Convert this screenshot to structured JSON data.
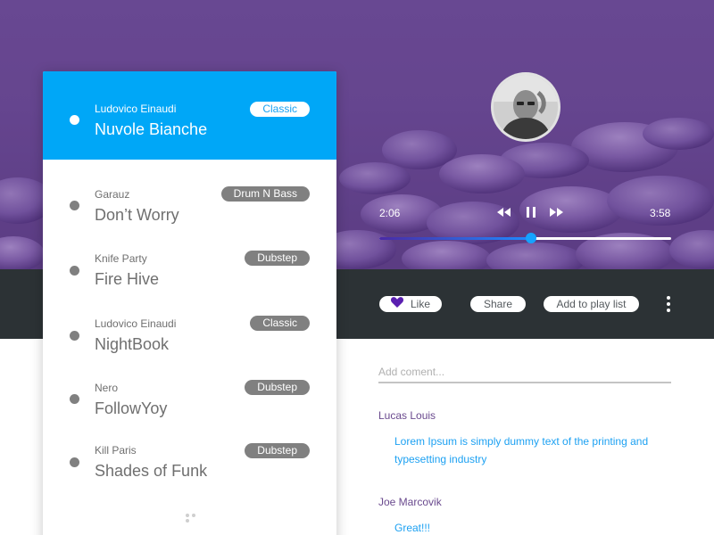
{
  "player": {
    "current_time": "2:06",
    "total_time": "3:58",
    "progress": 0.52,
    "controls": [
      "rewind-icon",
      "pause-icon",
      "fast-forward-icon"
    ]
  },
  "actions": {
    "like_label": "Like",
    "share_label": "Share",
    "add_label": "Add to play list"
  },
  "comments": {
    "placeholder": "Add coment...",
    "items": [
      {
        "author": "Lucas Louis",
        "text": "Lorem Ipsum is simply dummy text of the printing and typesetting industry"
      },
      {
        "author": "Joe Marcovik",
        "text": "Great!!!"
      }
    ]
  },
  "playlist": {
    "items": [
      {
        "artist": "Ludovico Einaudi",
        "title": "Nuvole Bianche",
        "genre": "Classic",
        "active": true
      },
      {
        "artist": "Garauz",
        "title": "Don’t Worry",
        "genre": "Drum N Bass",
        "active": false
      },
      {
        "artist": "Knife Party",
        "title": "Fire Hive",
        "genre": "Dubstep",
        "active": false
      },
      {
        "artist": "Ludovico Einaudi",
        "title": "NightBook",
        "genre": "Classic",
        "active": false
      },
      {
        "artist": "Nero",
        "title": "FollowYoy",
        "genre": "Dubstep",
        "active": false
      },
      {
        "artist": "Kill Paris",
        "title": "Shades of Funk",
        "genre": "Dubstep",
        "active": false
      }
    ]
  },
  "colors": {
    "accent": "#00a7f7",
    "hero_purple": "#6a4b90",
    "dark_bar": "#2c3235",
    "comment_author": "#6a4a8e",
    "comment_text": "#1da1f2",
    "heart": "#5a1fb0"
  }
}
